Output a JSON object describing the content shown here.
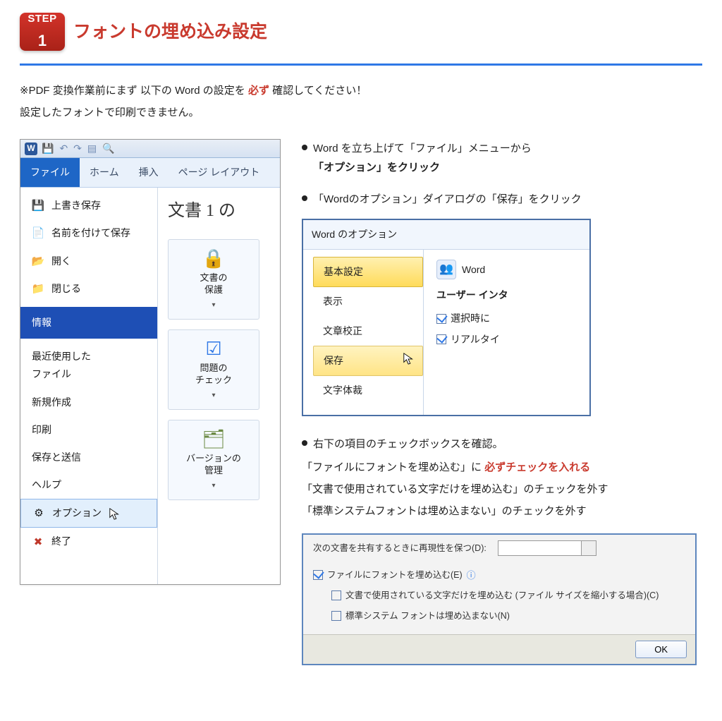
{
  "header": {
    "badge_top": "STEP",
    "badge_num": "1",
    "title": "フォントの埋め込み設定"
  },
  "intro": {
    "line1_a": "※PDF 変換作業前にまず 以下の Word の設定を",
    "line1_emph": "必ず",
    "line1_b": "確認してください！",
    "line2": "設定したフォントで印刷できません。"
  },
  "word_shot": {
    "logo": "W",
    "tabs": {
      "file": "ファイル",
      "home": "ホーム",
      "insert": "挿入",
      "layout": "ページ レイアウト"
    },
    "file_menu": {
      "save": "上書き保存",
      "saveas": "名前を付けて保存",
      "open": "開く",
      "close": "閉じる",
      "info": "情報",
      "recent": "最近使用した\nファイル",
      "new": "新規作成",
      "print": "印刷",
      "share": "保存と送信",
      "help": "ヘルプ",
      "options": "オプション",
      "exit": "終了"
    },
    "right": {
      "doc_title": "文書 1 の",
      "protect": "文書の\n保護",
      "check": "問題の\nチェック",
      "versions": "バージョンの\n管理"
    }
  },
  "bullets": {
    "b1a": "Word を立ち上げて「ファイル」メニューから",
    "b1b": "「オプション」をクリック",
    "b2": "「Wordのオプション」ダイアログの「保存」をクリック",
    "b3": "右下の項目のチェックボックスを確認。"
  },
  "opt_dialog": {
    "title": "Word のオプション",
    "cats": {
      "basic": "基本設定",
      "view": "表示",
      "proof": "文章校正",
      "save": "保存",
      "typo": "文字体裁"
    },
    "right": {
      "word": "Word",
      "sub": "ユーザー インタ",
      "c1": "選択時に",
      "c2": "リアルタイ"
    }
  },
  "check_para": {
    "p1a": "「ファイルにフォントを埋め込む」に",
    "p1emph": "必ずチェックを入れる",
    "p2": "「文書で使用されている文字だけを埋め込む」のチェックを外す",
    "p3": "「標準システムフォントは埋め込まない」のチェックを外す"
  },
  "chk_dialog": {
    "row1": "次の文書を共有するときに再現性を保つ(D):",
    "c1": "ファイルにフォントを埋め込む(E)",
    "c2": "文書で使用されている文字だけを埋め込む (ファイル サイズを縮小する場合)(C)",
    "c3": "標準システム フォントは埋め込まない(N)",
    "ok": "OK"
  }
}
